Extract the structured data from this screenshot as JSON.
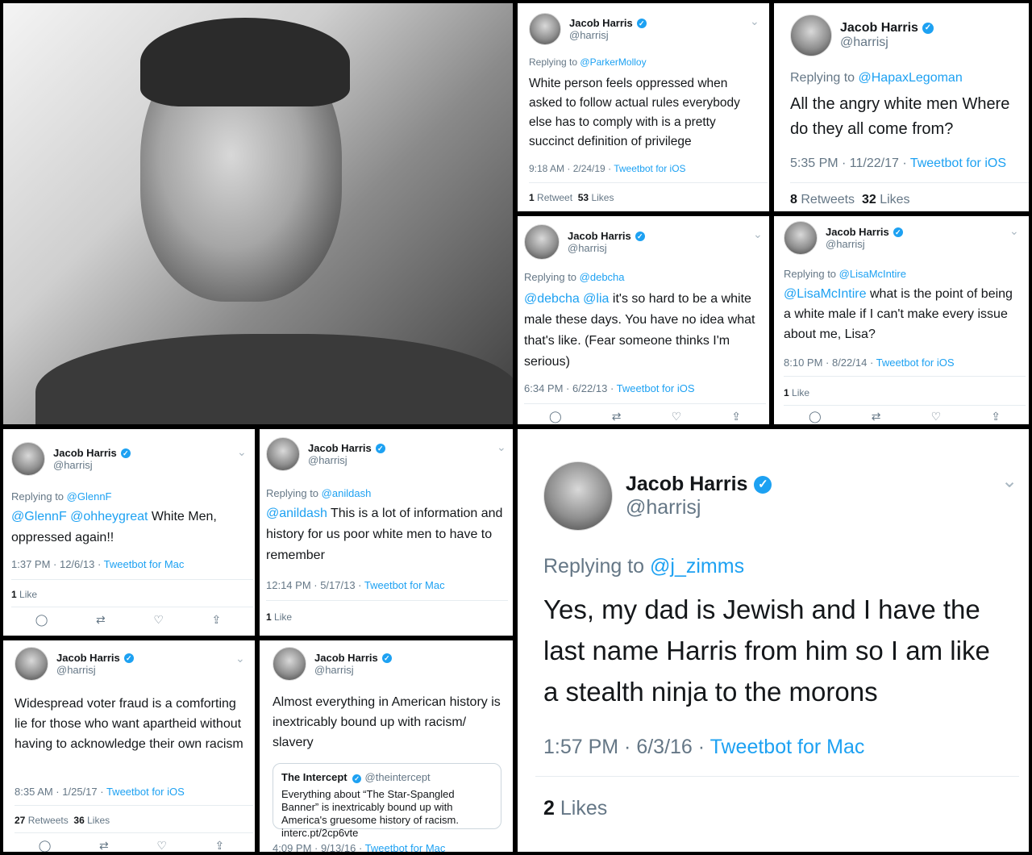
{
  "author": {
    "name": "Jacob Harris",
    "handle": "@harrisj"
  },
  "icons": {
    "verified": "verified-badge-icon",
    "chevron": "chevron-down-icon",
    "reply": "reply-icon",
    "retweet": "retweet-icon",
    "like": "like-icon",
    "share": "share-icon"
  },
  "colors": {
    "link": "#1da1f2",
    "muted": "#657786",
    "text": "#14171a"
  },
  "tweets": [
    {
      "reply_prefix": "Replying to",
      "reply_to": "@ParkerMolloy",
      "text": "White person feels oppressed when asked to follow actual rules everybody else has to comply with is a pretty succinct definition of privilege",
      "time": "9:18 AM · 2/24/19 · ",
      "source": "Tweetbot for iOS",
      "retweets": "1",
      "retweets_label": "Retweet",
      "likes": "53",
      "likes_label": "Likes"
    },
    {
      "reply_prefix": "Replying to",
      "reply_to": "@HapaxLegoman",
      "text": "All the angry white men Where do they all come from?",
      "time": "5:35 PM · 11/22/17 · ",
      "source": "Tweetbot for iOS",
      "retweets": "8",
      "retweets_label": "Retweets",
      "likes": "32",
      "likes_label": "Likes"
    },
    {
      "reply_prefix": "Replying to",
      "reply_to": "@debcha",
      "mentions": "@debcha @lia",
      "text": " it's so hard to be a white male these days. You have no idea what that's like. (Fear someone thinks I'm serious)",
      "time": "6:34 PM · 6/22/13 · ",
      "source": "Tweetbot for iOS"
    },
    {
      "reply_prefix": "Replying to",
      "reply_to": "@LisaMcIntire",
      "mentions": "@LisaMcIntire",
      "text": " what is the point of being a white male if I can't make every issue about me, Lisa?",
      "time": "8:10 PM · 8/22/14 · ",
      "source": "Tweetbot for iOS",
      "likes": "1",
      "likes_label": "Like"
    },
    {
      "reply_prefix": "Replying to",
      "reply_to": "@GlennF",
      "mentions": "@GlennF @ohheygreat",
      "text": " White Men, oppressed again!!",
      "time": "1:37 PM · 12/6/13 · ",
      "source": "Tweetbot for Mac",
      "likes": "1",
      "likes_label": "Like"
    },
    {
      "reply_prefix": "Replying to",
      "reply_to": "@anildash",
      "mentions": "@anildash",
      "text": " This is a lot of information and history for us poor white men to have to remember",
      "time": "12:14 PM · 5/17/13 · ",
      "source": "Tweetbot for Mac",
      "likes": "1",
      "likes_label": "Like"
    },
    {
      "reply_prefix": "Replying to",
      "reply_to": "@j_zimms",
      "text": "Yes, my dad is Jewish and I have the last name Harris from him so I am like a stealth ninja to the morons",
      "time": "1:57 PM · 6/3/16 · ",
      "source": "Tweetbot for Mac",
      "likes": "2",
      "likes_label": "Likes"
    },
    {
      "text": "Widespread voter fraud is a comforting lie for those who want apartheid without having to acknowledge their own racism",
      "time": "8:35 AM · 1/25/17 · ",
      "source": "Tweetbot for iOS",
      "retweets": "27",
      "retweets_label": "Retweets",
      "likes": "36",
      "likes_label": "Likes"
    },
    {
      "text": "Almost everything in American history is inextricably bound up with racism/ slavery",
      "quote_name": "The Intercept",
      "quote_handle": "@theintercept",
      "quote_text": "Everything about “The Star-Spangled Banner” is inextricably bound up with America's gruesome history of racism. interc.pt/2cp6vte",
      "time": "4:09 PM · 9/13/16 · ",
      "source": "Tweetbot for Mac"
    }
  ]
}
